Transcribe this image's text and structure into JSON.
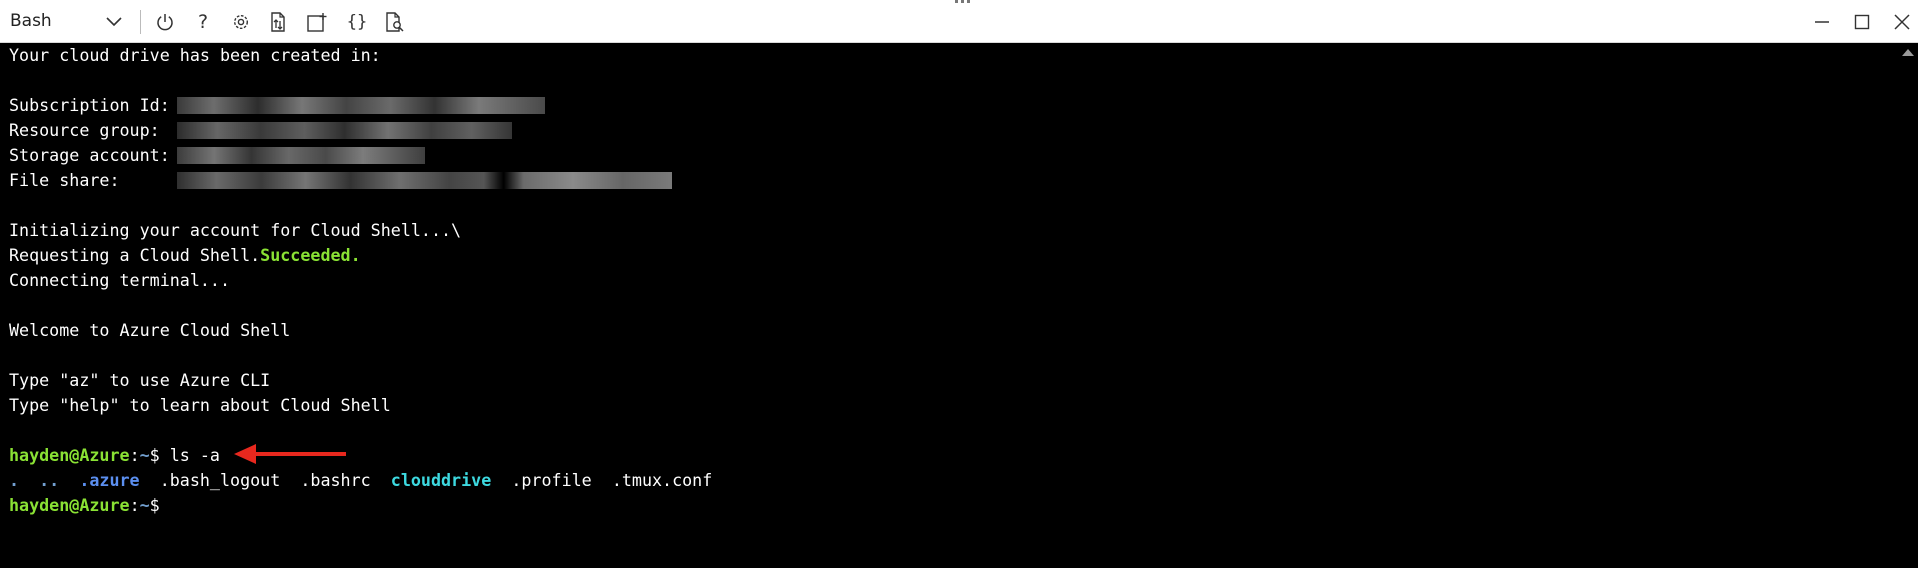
{
  "toolbar": {
    "shell": "Bash",
    "buttons": [
      {
        "name": "restart-icon"
      },
      {
        "name": "help-icon",
        "glyph": "?"
      },
      {
        "name": "settings-icon"
      },
      {
        "name": "upload-download-icon"
      },
      {
        "name": "new-session-icon"
      },
      {
        "name": "editor-icon",
        "glyph": "{}"
      },
      {
        "name": "web-preview-icon"
      }
    ],
    "window_controls": [
      "minimize-icon",
      "maximize-icon",
      "close-icon"
    ]
  },
  "terminal": {
    "cloud_drive_header": "Your cloud drive has been created in:",
    "info": {
      "subscription_label": "Subscription Id:",
      "resource_group_label": "Resource group:",
      "storage_account_label": "Storage account:",
      "file_share_label": "File share:"
    },
    "initializing": "Initializing your account for Cloud Shell...\\",
    "requesting": "Requesting a Cloud Shell.",
    "succeeded": "Succeeded.",
    "connecting": "Connecting terminal...",
    "welcome": "Welcome to Azure Cloud Shell",
    "az_hint": "Type \"az\" to use Azure CLI",
    "help_hint": "Type \"help\" to learn about Cloud Shell",
    "prompt_user": "hayden@Azure",
    "prompt_colon": ":",
    "prompt_path": "~",
    "prompt_symbol": "$",
    "command": " ls -a",
    "ls_output": {
      "dot": ".",
      "dotdot": "..",
      "azure": ".azure",
      "bash_logout": ".bash_logout",
      "bashrc": ".bashrc",
      "clouddrive": "clouddrive",
      "profile": ".profile",
      "tmux": ".tmux.conf"
    }
  },
  "colors": {
    "prompt_green": "#8ae234",
    "path_blue": "#729fcf",
    "arrow_red": "#e8281e"
  }
}
